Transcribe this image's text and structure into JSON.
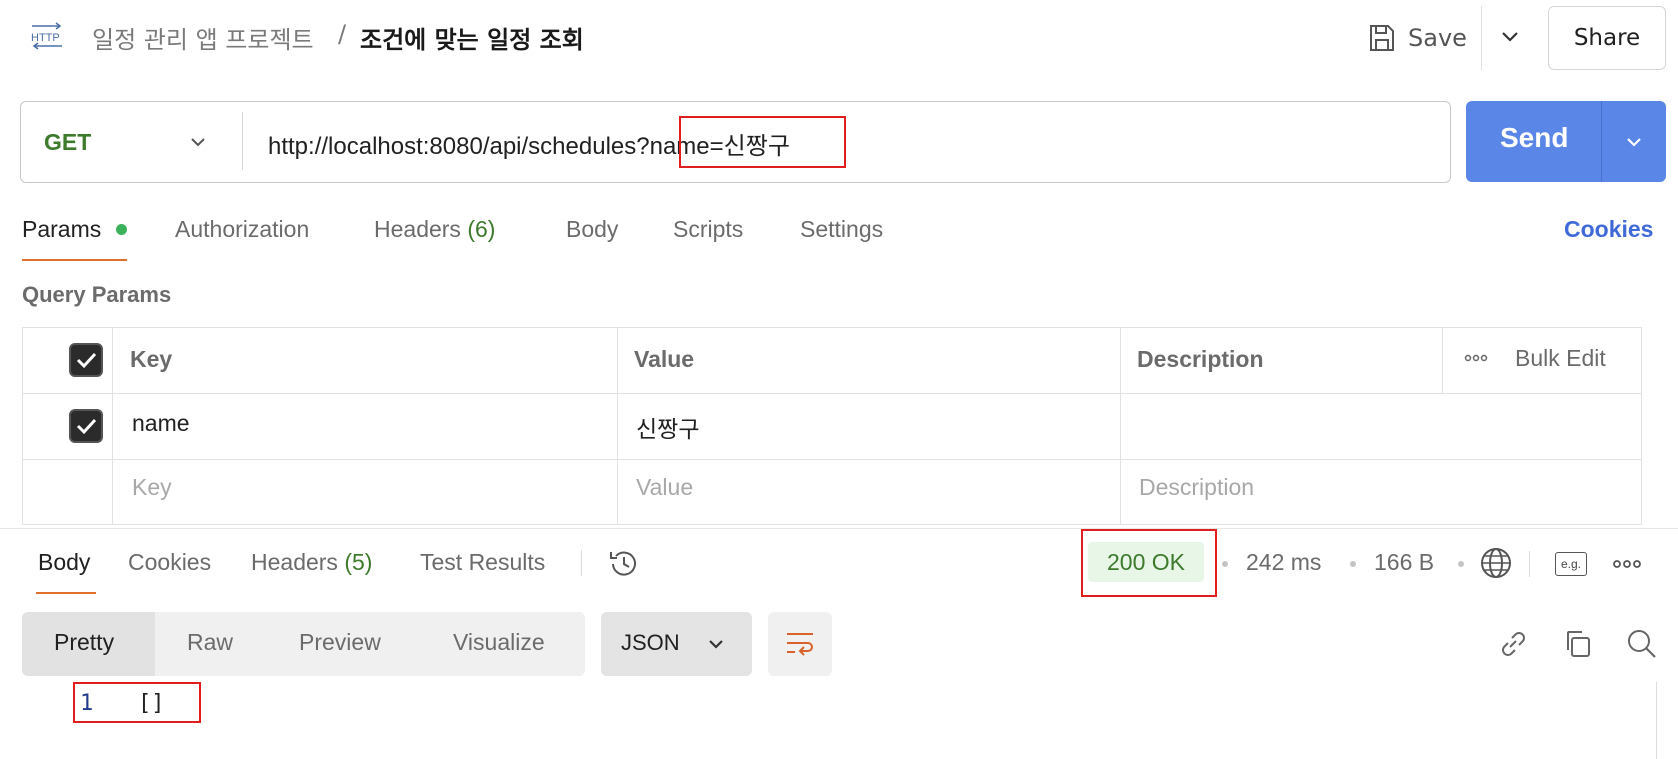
{
  "header": {
    "icon": "http-icon",
    "breadcrumb_parent": "일정 관리 앱 프로젝트",
    "breadcrumb_separator": "/",
    "title": "조건에 맞는 일정 조회",
    "save_label": "Save",
    "share_label": "Share"
  },
  "request": {
    "method": "GET",
    "url_base": "http://localhost:8080/api/schedules?",
    "url_query": "name=신짱구",
    "send_label": "Send",
    "method_color": "#3d7a2c",
    "send_color": "#5a86e8"
  },
  "request_tabs": {
    "params": "Params",
    "authorization": "Authorization",
    "headers": "Headers",
    "headers_count": "(6)",
    "body": "Body",
    "scripts": "Scripts",
    "settings": "Settings",
    "cookies": "Cookies"
  },
  "query_params": {
    "label": "Query Params",
    "columns": {
      "key": "Key",
      "value": "Value",
      "description": "Description",
      "bulk_edit": "Bulk Edit"
    },
    "rows": [
      {
        "checked": true,
        "key": "name",
        "value": "신짱구",
        "description": ""
      }
    ],
    "placeholders": {
      "key": "Key",
      "value": "Value",
      "description": "Description"
    }
  },
  "response_tabs": {
    "body": "Body",
    "cookies": "Cookies",
    "headers": "Headers",
    "headers_count": "(5)",
    "test_results": "Test Results"
  },
  "response_meta": {
    "status": "200 OK",
    "time": "242 ms",
    "size": "166 B",
    "example_label": "e.g."
  },
  "view_modes": {
    "pretty": "Pretty",
    "raw": "Raw",
    "preview": "Preview",
    "visualize": "Visualize",
    "format": "JSON"
  },
  "response_body": {
    "line_number": "1",
    "content": "[]"
  },
  "colors": {
    "accent_orange": "#e0702b",
    "highlight_red": "#e01e1e",
    "status_green": "#3d7a2c",
    "link_blue": "#3f6ad8"
  }
}
